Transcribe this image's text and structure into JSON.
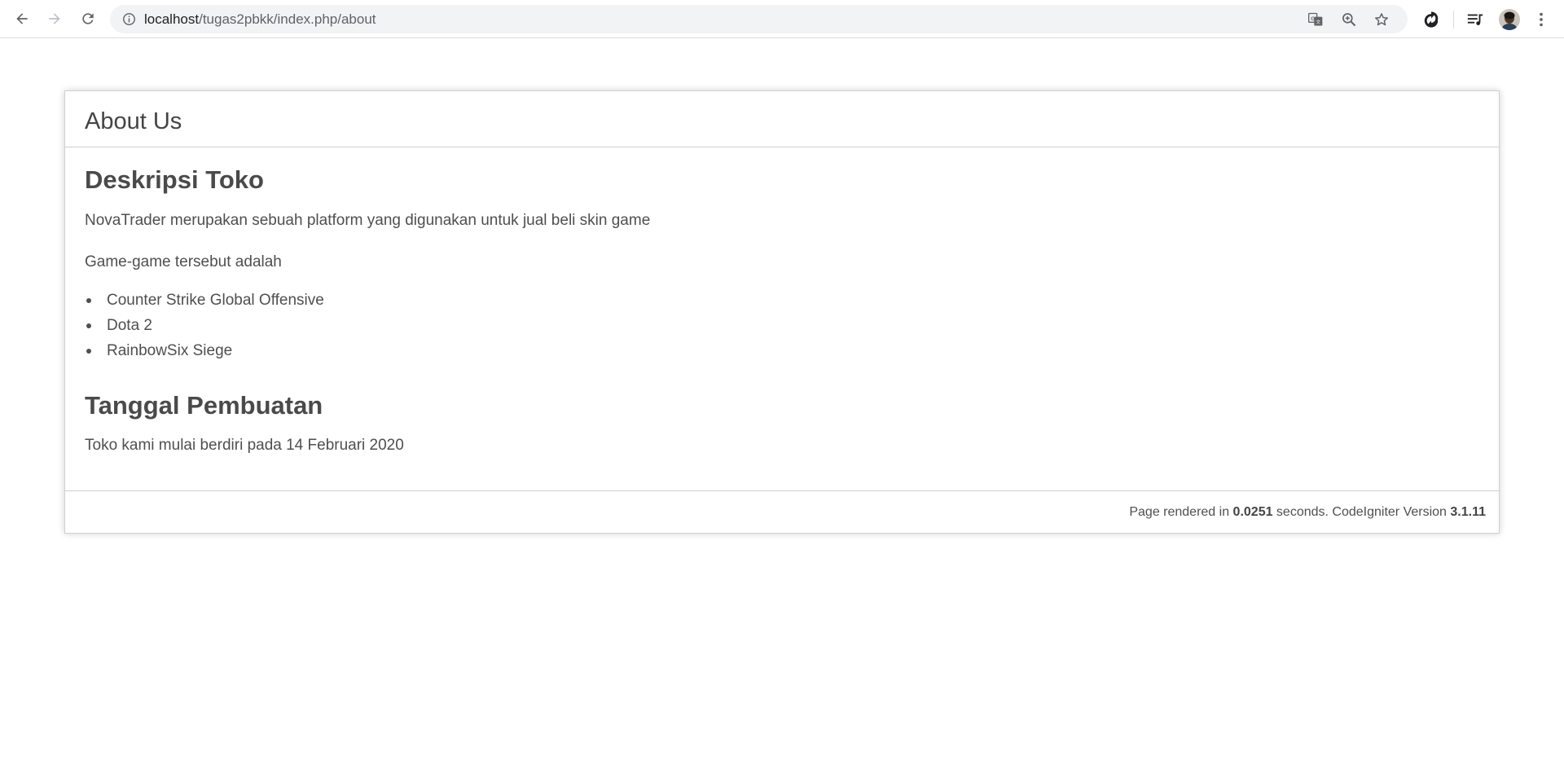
{
  "browser": {
    "url_host": "localhost",
    "url_path": "/tugas2pbkk/index.php/about",
    "icons": {
      "back": "arrow-left-icon",
      "forward": "arrow-right-icon",
      "reload": "reload-icon",
      "info": "info-icon",
      "translate": "translate-icon",
      "zoom": "zoom-icon",
      "bookmark": "star-icon",
      "extension": "extension-icon",
      "media": "media-controls-icon",
      "menu": "kebab-menu-icon"
    }
  },
  "page": {
    "header_title": "About Us",
    "section1": {
      "heading": "Deskripsi Toko",
      "paragraph1": "NovaTrader merupakan sebuah platform yang digunakan untuk jual beli skin game",
      "paragraph2": "Game-game tersebut adalah",
      "games": [
        "Counter Strike Global Offensive",
        "Dota 2",
        "RainbowSix Siege"
      ]
    },
    "section2": {
      "heading": "Tanggal Pembuatan",
      "paragraph": "Toko kami mulai berdiri pada 14 Februari 2020"
    },
    "footer": {
      "prefix": "Page rendered in ",
      "seconds": "0.0251",
      "middle": " seconds. CodeIgniter Version ",
      "version": "3.1.11"
    }
  },
  "colors": {
    "text": "#4f4f4f",
    "border": "#d0d0d0",
    "omnibox_bg": "#f1f3f4"
  }
}
